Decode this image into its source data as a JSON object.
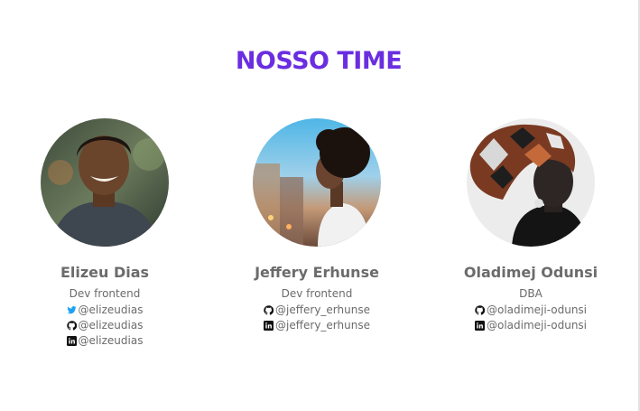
{
  "section": {
    "title": "NOSSO TIME"
  },
  "colors": {
    "accent": "#6a2ee0",
    "text": "#6b6b6b",
    "twitter": "#1da1f2",
    "icon_dark": "#111111"
  },
  "members": [
    {
      "name": "Elizeu Dias",
      "role": "Dev frontend",
      "socials": [
        {
          "icon": "twitter-icon",
          "handle": "@elizeudias"
        },
        {
          "icon": "github-icon",
          "handle": "@elizeudias"
        },
        {
          "icon": "linkedin-icon",
          "handle": "@elizeudias"
        }
      ]
    },
    {
      "name": "Jeffery Erhunse",
      "role": "Dev frontend",
      "socials": [
        {
          "icon": "github-icon",
          "handle": "@jeffery_erhunse"
        },
        {
          "icon": "linkedin-icon",
          "handle": "@jeffery_erhunse"
        }
      ]
    },
    {
      "name": "Oladimej Odunsi",
      "role": "DBA",
      "socials": [
        {
          "icon": "github-icon",
          "handle": "@oladimeji-odunsi"
        },
        {
          "icon": "linkedin-icon",
          "handle": "@oladimeji-odunsi"
        }
      ]
    }
  ]
}
